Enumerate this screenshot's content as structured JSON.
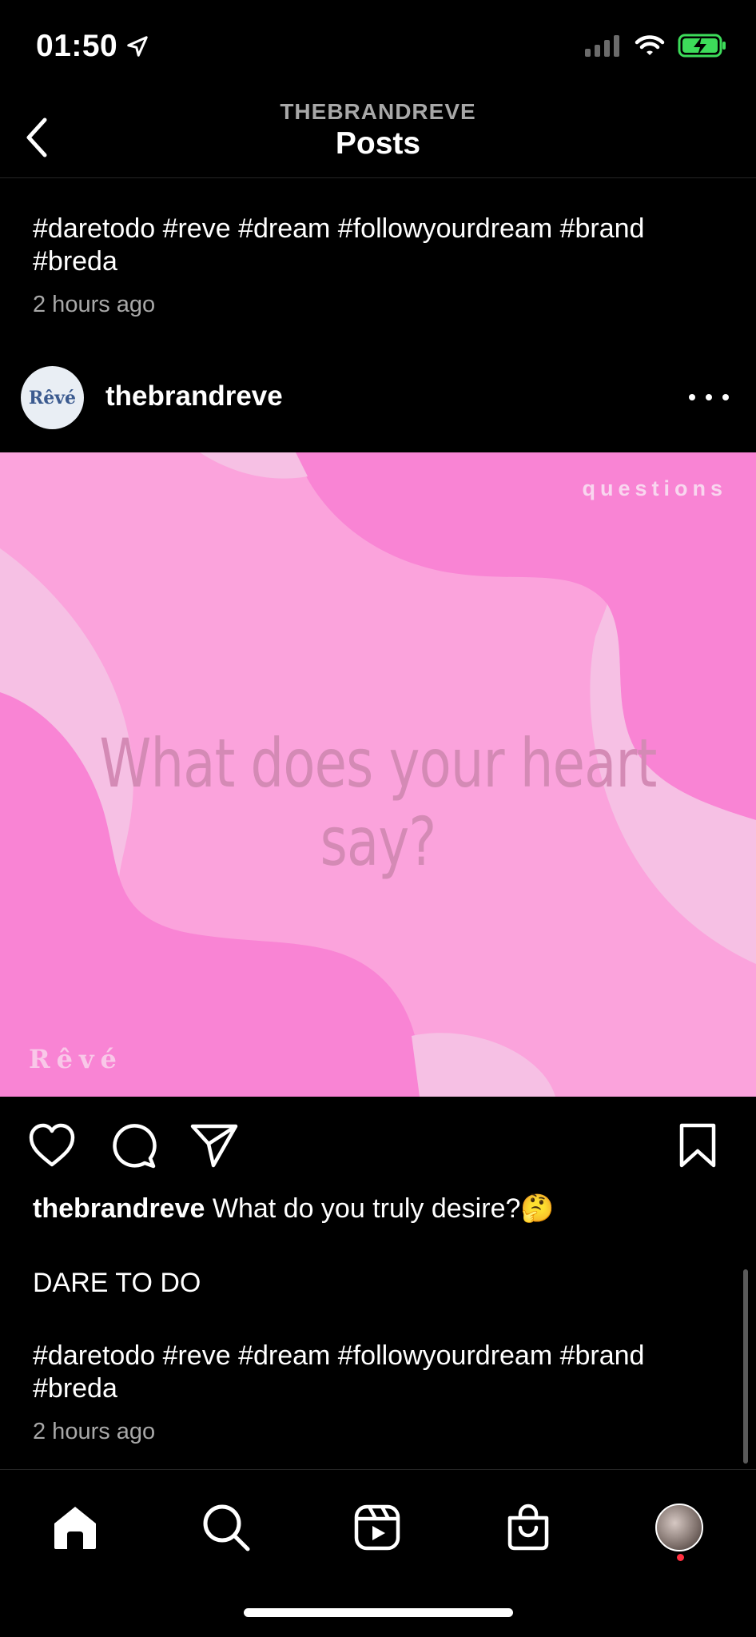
{
  "status_bar": {
    "time": "01:50"
  },
  "header": {
    "account": "THEBRANDREVE",
    "title": "Posts"
  },
  "previous_post": {
    "caption": "#daretodo #reve #dream #followyourdream #brand #breda",
    "time_ago": "2 hours ago"
  },
  "post": {
    "avatar_text": "Rêvé",
    "username": "thebrandreve",
    "image": {
      "tag": "questions",
      "question": "What does your heart say?",
      "brand": "Rêvé",
      "colors": {
        "background": "#fba3dc",
        "blob": "#f984d4",
        "wave": "#f6c0e4",
        "text": "#d48ab5"
      }
    },
    "caption_username": "thebrandreve",
    "caption_text": "What do you truly desire?🤔",
    "caption_line2": "DARE TO DO",
    "caption_tags": "#daretodo #reve #dream #followyourdream #brand #breda",
    "time_ago": "2 hours ago"
  },
  "icons": {
    "back": "chevron-left-icon",
    "more": "more-horizontal-icon",
    "like": "heart-icon",
    "comment": "comment-icon",
    "share": "paper-plane-icon",
    "save": "bookmark-icon",
    "home": "home-icon",
    "search": "search-icon",
    "reels": "reels-icon",
    "shop": "shopping-bag-icon"
  }
}
